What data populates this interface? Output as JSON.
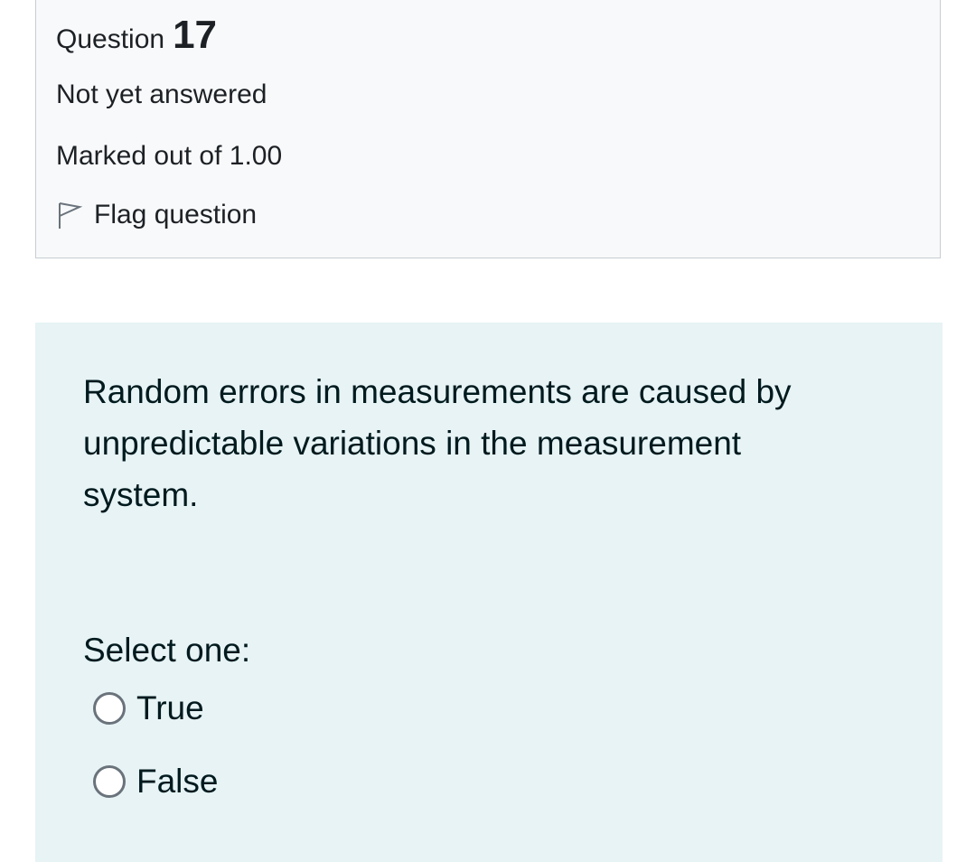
{
  "question_info": {
    "question_word": "Question",
    "question_number": "17",
    "state": "Not yet answered",
    "grade": "Marked out of 1.00",
    "flag": {
      "icon": "flag-outline-icon",
      "label": "Flag question"
    }
  },
  "question_content": {
    "text": "Random errors in measurements are caused by unpredictable variations in the measurement system.",
    "prompt": "Select one:",
    "options": [
      {
        "label": "True",
        "selected": false
      },
      {
        "label": "False",
        "selected": false
      }
    ]
  }
}
